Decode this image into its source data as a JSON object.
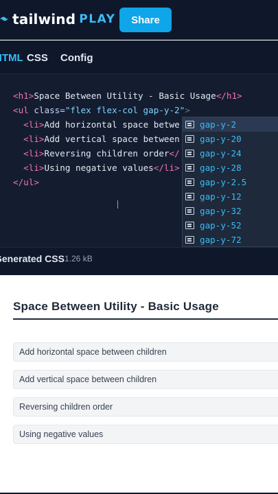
{
  "header": {
    "logo_word": "tailwind",
    "logo_play": "PLAY",
    "share_label": "Share"
  },
  "tabs": [
    {
      "label": "HTML",
      "active": true
    },
    {
      "label": "CSS",
      "active": false
    },
    {
      "label": "Config",
      "active": false
    }
  ],
  "editor": {
    "lines": {
      "l1": {
        "open": "<h1>",
        "text": "Space Between Utility - Basic Usage",
        "close": "</h1>"
      },
      "l2": {
        "open": "<ul",
        "attr": " class=",
        "value": "\"flex flex-col gap-y-2\"",
        "end": ">"
      },
      "l3": {
        "open": "<li>",
        "text": "Add horizontal space betwe"
      },
      "l4": {
        "open": "<li>",
        "text": "Add vertical space between"
      },
      "l5": {
        "open": "<li>",
        "text": "Reversing children order",
        "close": "</"
      },
      "l6": {
        "open": "<li>",
        "text": "Using negative values",
        "close": "</li>"
      },
      "l7": {
        "close": "</ul>"
      }
    },
    "suggestions": [
      "gap-y-2",
      "gap-y-20",
      "gap-y-24",
      "gap-y-28",
      "gap-y-2.5",
      "gap-y-12",
      "gap-y-32",
      "gap-y-52",
      "gap-y-72"
    ]
  },
  "generated_css": {
    "label": "Generated CSS",
    "size": "1.26 kB"
  },
  "preview": {
    "title": "Space Between Utility - Basic Usage",
    "items": [
      "Add horizontal space between children",
      "Add vertical space between children",
      "Reversing children order",
      "Using negative values"
    ]
  },
  "colors": {
    "brand": "#38bdf8",
    "share_button": "#0ea5e9",
    "editor_bg": "#141d30",
    "tag": "#f472b6"
  }
}
